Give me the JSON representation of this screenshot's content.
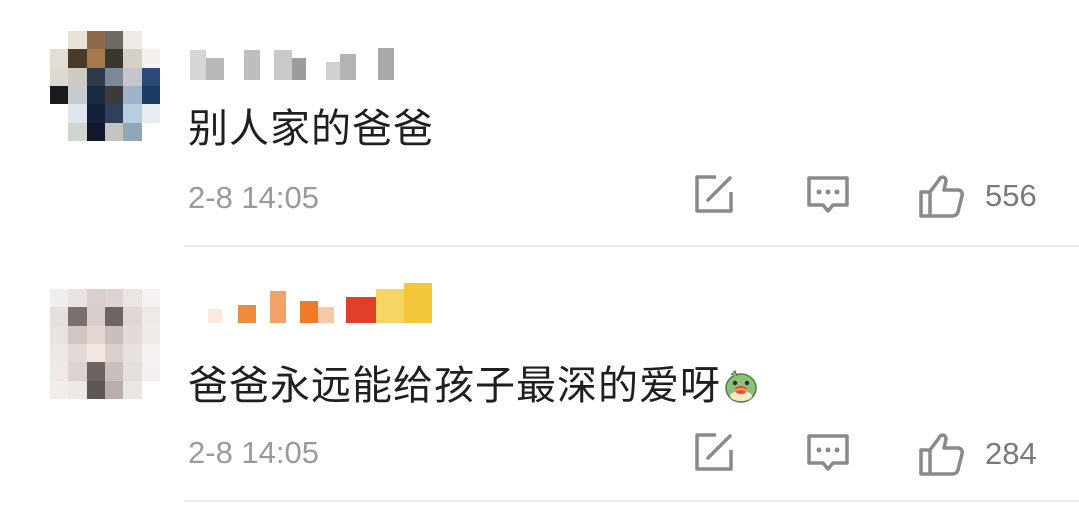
{
  "comments": [
    {
      "text": "别人家的爸爸",
      "timestamp": "2-8 14:05",
      "likes": "556",
      "username_pixelated": true,
      "avatar_pixelated": true
    },
    {
      "text": "爸爸永远能给孩子最深的爱呀",
      "emoji": "bird-eating-emoji",
      "timestamp": "2-8 14:05",
      "likes": "284",
      "username_pixelated": true,
      "avatar_pixelated": true
    }
  ],
  "icons": {
    "repost": "repost-icon",
    "comment": "comment-icon",
    "like": "thumbs-up-icon"
  },
  "colors": {
    "text": "#1f1f1f",
    "meta": "#9a9a9a",
    "icon": "#8a8a8a",
    "divider": "#ececec"
  }
}
